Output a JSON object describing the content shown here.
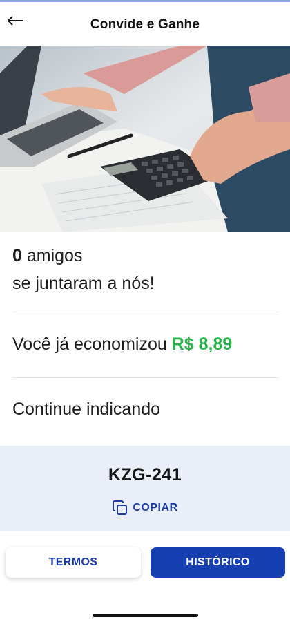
{
  "header": {
    "back_icon": "arrow-left-icon",
    "title": "Convide e Ganhe"
  },
  "hero": {
    "image": "photo: hands using a calculator and laptop over paperwork"
  },
  "friends": {
    "count": "0",
    "label_line1": "amigos",
    "label_line2": "se juntaram a nós!"
  },
  "savings": {
    "label": "Você já economizou",
    "amount": "R$ 8,89",
    "amount_color": "#27b24a"
  },
  "keep_referring": "Continue indicando",
  "referral": {
    "code": "KZG-241",
    "copy_label": "COPIAR",
    "copy_icon": "copy-icon"
  },
  "buttons": {
    "terms": "TERMOS",
    "history": "HISTÓRICO"
  },
  "colors": {
    "primary": "#1640b1",
    "code_bg": "#e9eef9"
  }
}
